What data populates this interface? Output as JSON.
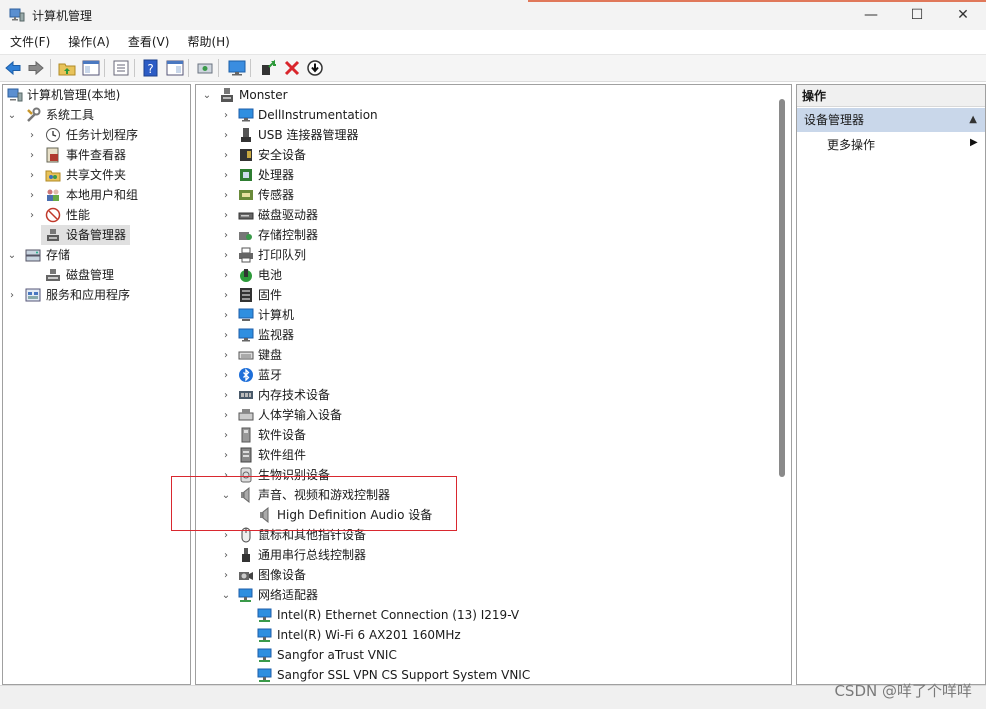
{
  "window": {
    "title": "计算机管理",
    "minimize": "—",
    "maximize": "☐",
    "close": "✕"
  },
  "menu": [
    "文件(F)",
    "操作(A)",
    "查看(V)",
    "帮助(H)"
  ],
  "left_tree": [
    {
      "label": "计算机管理(本地)",
      "chev": "",
      "icon": "computer-management-icon"
    },
    {
      "label": "系统工具",
      "chev": "⌄",
      "icon": "tools-icon"
    },
    {
      "label": "任务计划程序",
      "chev": "›",
      "icon": "clock-icon"
    },
    {
      "label": "事件查看器",
      "chev": "›",
      "icon": "event-viewer-icon"
    },
    {
      "label": "共享文件夹",
      "chev": "›",
      "icon": "shared-folder-icon"
    },
    {
      "label": "本地用户和组",
      "chev": "›",
      "icon": "users-icon"
    },
    {
      "label": "性能",
      "chev": "›",
      "icon": "performance-icon"
    },
    {
      "label": "设备管理器",
      "chev": "",
      "icon": "device-manager-icon"
    },
    {
      "label": "存储",
      "chev": "⌄",
      "icon": "storage-icon"
    },
    {
      "label": "磁盘管理",
      "chev": "",
      "icon": "disk-icon"
    },
    {
      "label": "服务和应用程序",
      "chev": "›",
      "icon": "services-icon"
    }
  ],
  "device_tree": [
    {
      "label": "Monster",
      "chev": "⌄",
      "icon": "computer-root-icon"
    },
    {
      "label": "DellInstrumentation",
      "chev": "›",
      "icon": "monitor-icon"
    },
    {
      "label": "USB 连接器管理器",
      "chev": "›",
      "icon": "usb-icon"
    },
    {
      "label": "安全设备",
      "chev": "›",
      "icon": "security-device-icon"
    },
    {
      "label": "处理器",
      "chev": "›",
      "icon": "processor-icon"
    },
    {
      "label": "传感器",
      "chev": "›",
      "icon": "sensor-icon"
    },
    {
      "label": "磁盘驱动器",
      "chev": "›",
      "icon": "disk-drive-icon"
    },
    {
      "label": "存储控制器",
      "chev": "›",
      "icon": "storage-controller-icon"
    },
    {
      "label": "打印队列",
      "chev": "›",
      "icon": "printer-icon"
    },
    {
      "label": "电池",
      "chev": "›",
      "icon": "battery-icon"
    },
    {
      "label": "固件",
      "chev": "›",
      "icon": "firmware-icon"
    },
    {
      "label": "计算机",
      "chev": "›",
      "icon": "computer-icon"
    },
    {
      "label": "监视器",
      "chev": "›",
      "icon": "monitor-icon"
    },
    {
      "label": "键盘",
      "chev": "›",
      "icon": "keyboard-icon"
    },
    {
      "label": "蓝牙",
      "chev": "›",
      "icon": "bluetooth-icon"
    },
    {
      "label": "内存技术设备",
      "chev": "›",
      "icon": "memory-icon"
    },
    {
      "label": "人体学输入设备",
      "chev": "›",
      "icon": "hid-icon"
    },
    {
      "label": "软件设备",
      "chev": "›",
      "icon": "software-device-icon"
    },
    {
      "label": "软件组件",
      "chev": "›",
      "icon": "software-component-icon"
    },
    {
      "label": "生物识别设备",
      "chev": "›",
      "icon": "biometric-icon"
    },
    {
      "label": "声音、视频和游戏控制器",
      "chev": "⌄",
      "icon": "speaker-icon"
    },
    {
      "label": "High Definition Audio 设备",
      "chev": "",
      "icon": "speaker-icon"
    },
    {
      "label": "鼠标和其他指针设备",
      "chev": "›",
      "icon": "mouse-icon"
    },
    {
      "label": "通用串行总线控制器",
      "chev": "›",
      "icon": "usb-controller-icon"
    },
    {
      "label": "图像设备",
      "chev": "›",
      "icon": "camera-icon"
    },
    {
      "label": "网络适配器",
      "chev": "⌄",
      "icon": "network-adapter-icon"
    },
    {
      "label": "Intel(R) Ethernet Connection (13) I219-V",
      "chev": "",
      "icon": "network-adapter-icon"
    },
    {
      "label": "Intel(R) Wi-Fi 6 AX201 160MHz",
      "chev": "",
      "icon": "network-adapter-icon"
    },
    {
      "label": "Sangfor aTrust VNIC",
      "chev": "",
      "icon": "network-adapter-icon"
    },
    {
      "label": "Sangfor SSL VPN CS Support System VNIC",
      "chev": "",
      "icon": "network-adapter-icon"
    }
  ],
  "actions": {
    "header": "操作",
    "section": "设备管理器",
    "more": "更多操作",
    "collapse_arrow": "▲",
    "more_arrow": "▶"
  },
  "watermark": "CSDN @咩了个咩咩",
  "colors": {
    "accent_selection": "#c9d7ea",
    "highlight_box": "#d9282f"
  }
}
